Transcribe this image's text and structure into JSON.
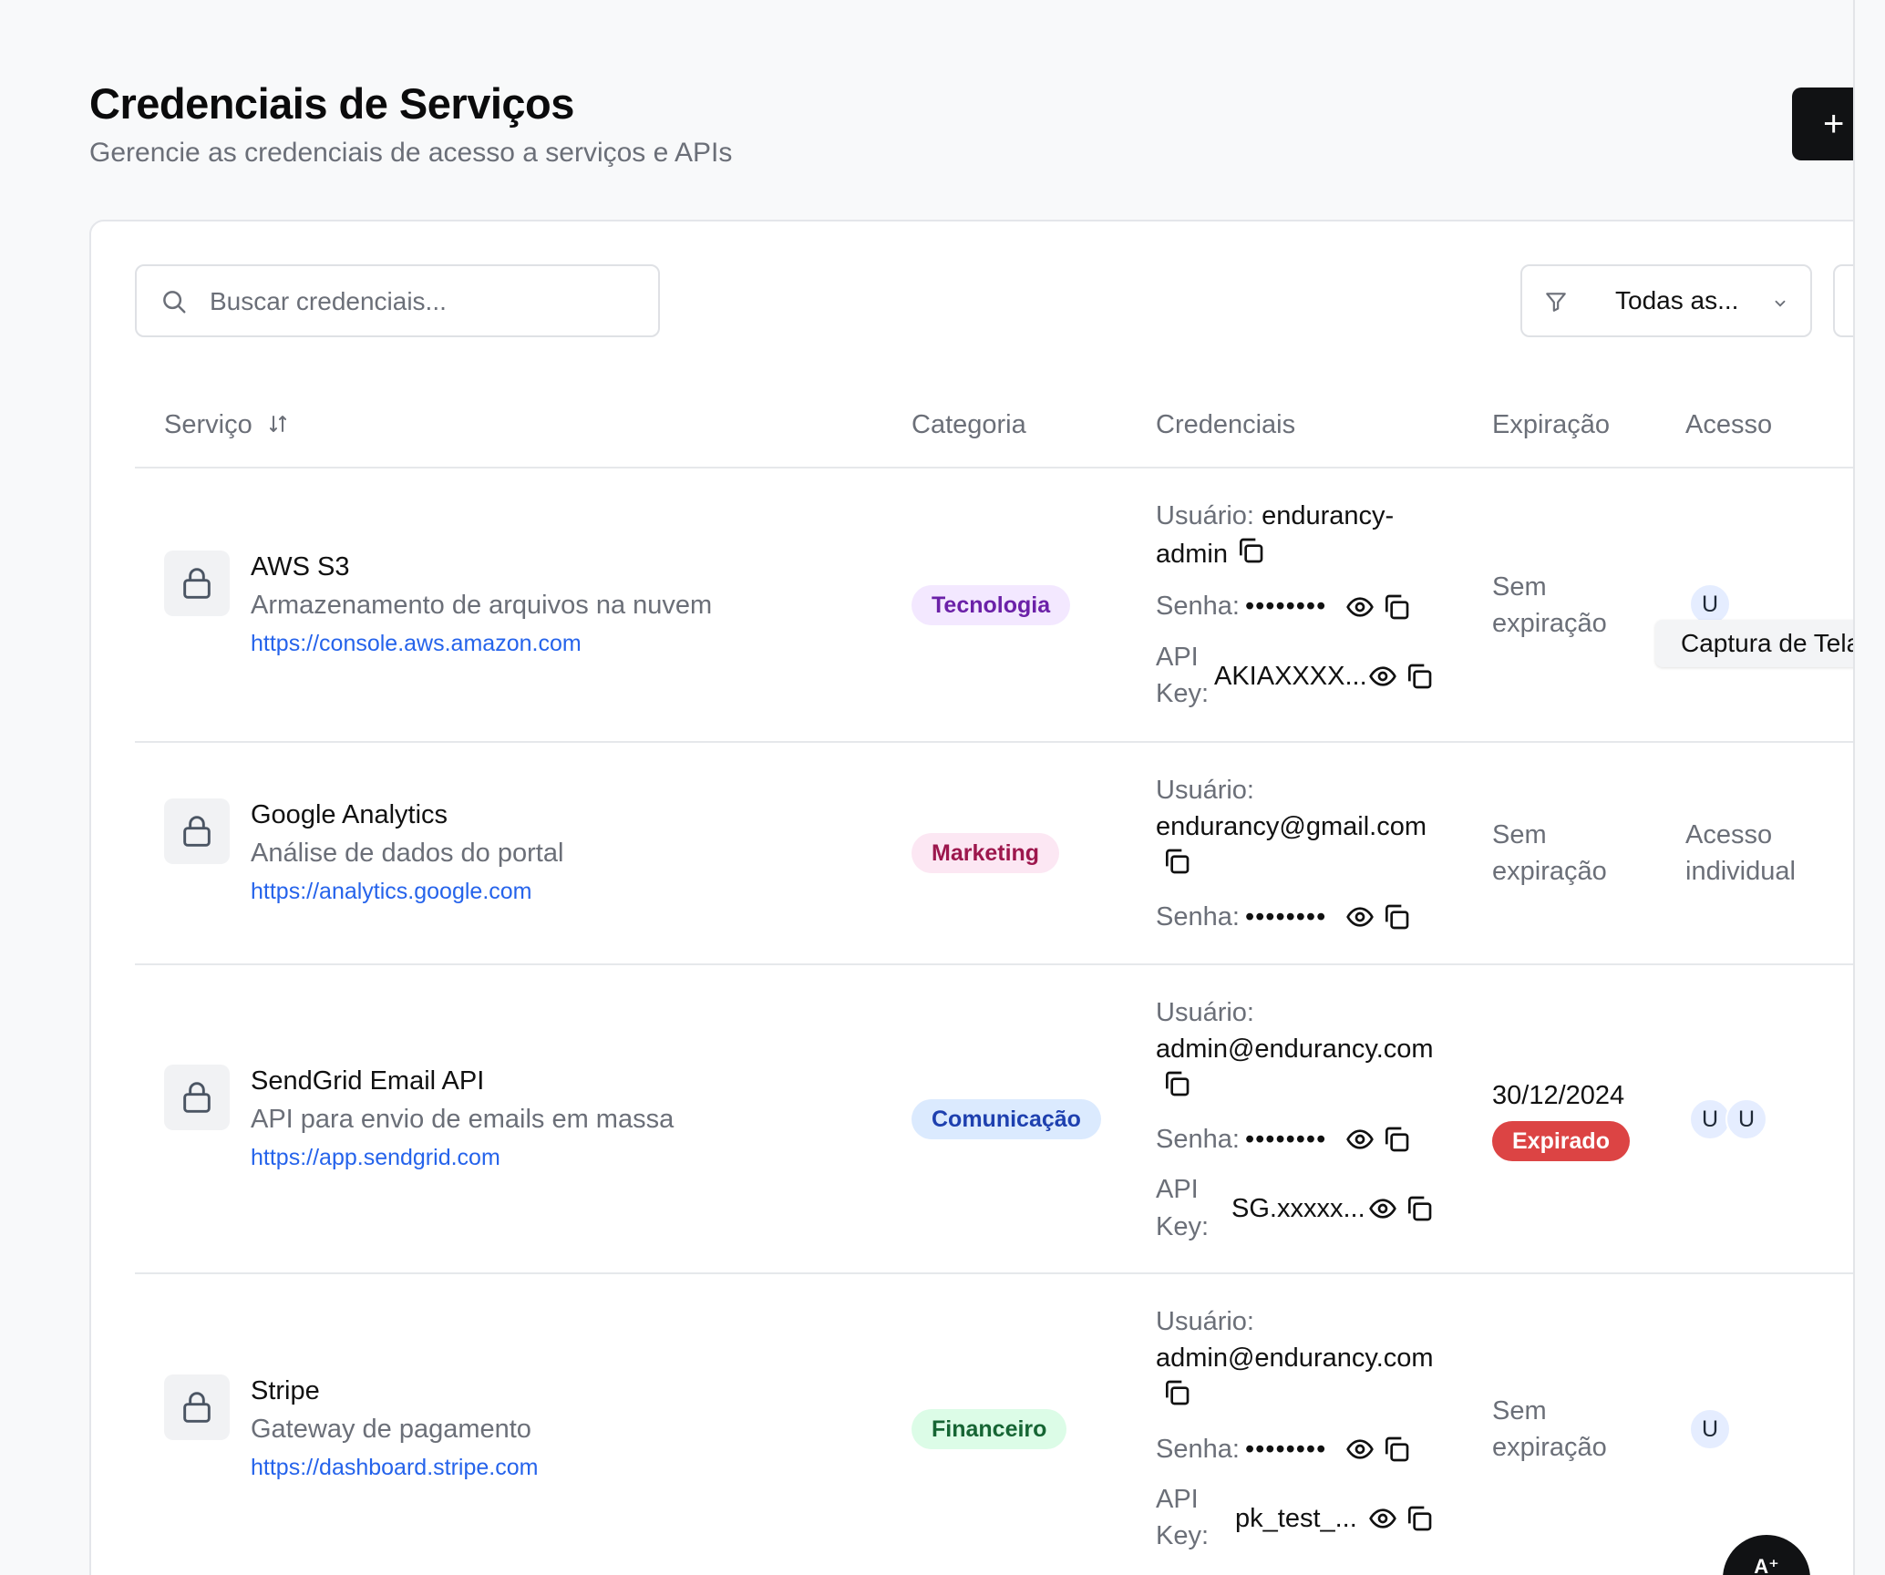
{
  "page": {
    "title": "Credenciais de Serviços",
    "subtitle": "Gerencie as credenciais de acesso a serviços e APIs",
    "add_label": "+"
  },
  "toolbar": {
    "search_placeholder": "Buscar credenciais...",
    "filter_label": "Todas as..."
  },
  "table": {
    "headers": {
      "service": "Serviço",
      "category": "Categoria",
      "credentials": "Credenciais",
      "expiration": "Expiração",
      "access": "Acesso"
    },
    "labels": {
      "user": "Usuário:",
      "password": "Senha:",
      "api": "API",
      "key": "Key:",
      "masked": "••••••••"
    },
    "rows": [
      {
        "name": "AWS S3",
        "description": "Armazenamento de arquivos na nuvem",
        "url": "https://console.aws.amazon.com",
        "category": "Tecnologia",
        "user_line1": "endurancy-",
        "user_line2": "admin",
        "api_key": "AKIAXXXX...",
        "exp_line1": "Sem",
        "exp_line2": "expiração",
        "access": [
          "U"
        ]
      },
      {
        "name": "Google Analytics",
        "description": "Análise de dados do portal",
        "url": "https://analytics.google.com",
        "category": "Marketing",
        "user": "endurancy@gmail.com",
        "exp_line1": "Sem",
        "exp_line2": "expiração",
        "access_line1": "Acesso",
        "access_line2": "individual"
      },
      {
        "name": "SendGrid Email API",
        "description": "API para envio de emails em massa",
        "url": "https://app.sendgrid.com",
        "category": "Comunicação",
        "user": "admin@endurancy.com",
        "api_key": "SG.xxxxx...",
        "exp_date": "30/12/2024",
        "exp_status": "Expirado",
        "access": [
          "U",
          "U"
        ]
      },
      {
        "name": "Stripe",
        "description": "Gateway de pagamento",
        "url": "https://dashboard.stripe.com",
        "category": "Financeiro",
        "user": "admin@endurancy.com",
        "api_key": "pk_test_...",
        "exp_line1": "Sem",
        "exp_line2": "expiração",
        "access": [
          "U"
        ]
      }
    ]
  },
  "tooltip": "Captura de Tela",
  "fab_label": "A⁺",
  "colors": {
    "primary": "#111214",
    "link": "#2563eb",
    "danger": "#dc4444",
    "muted": "#6b6f78"
  }
}
